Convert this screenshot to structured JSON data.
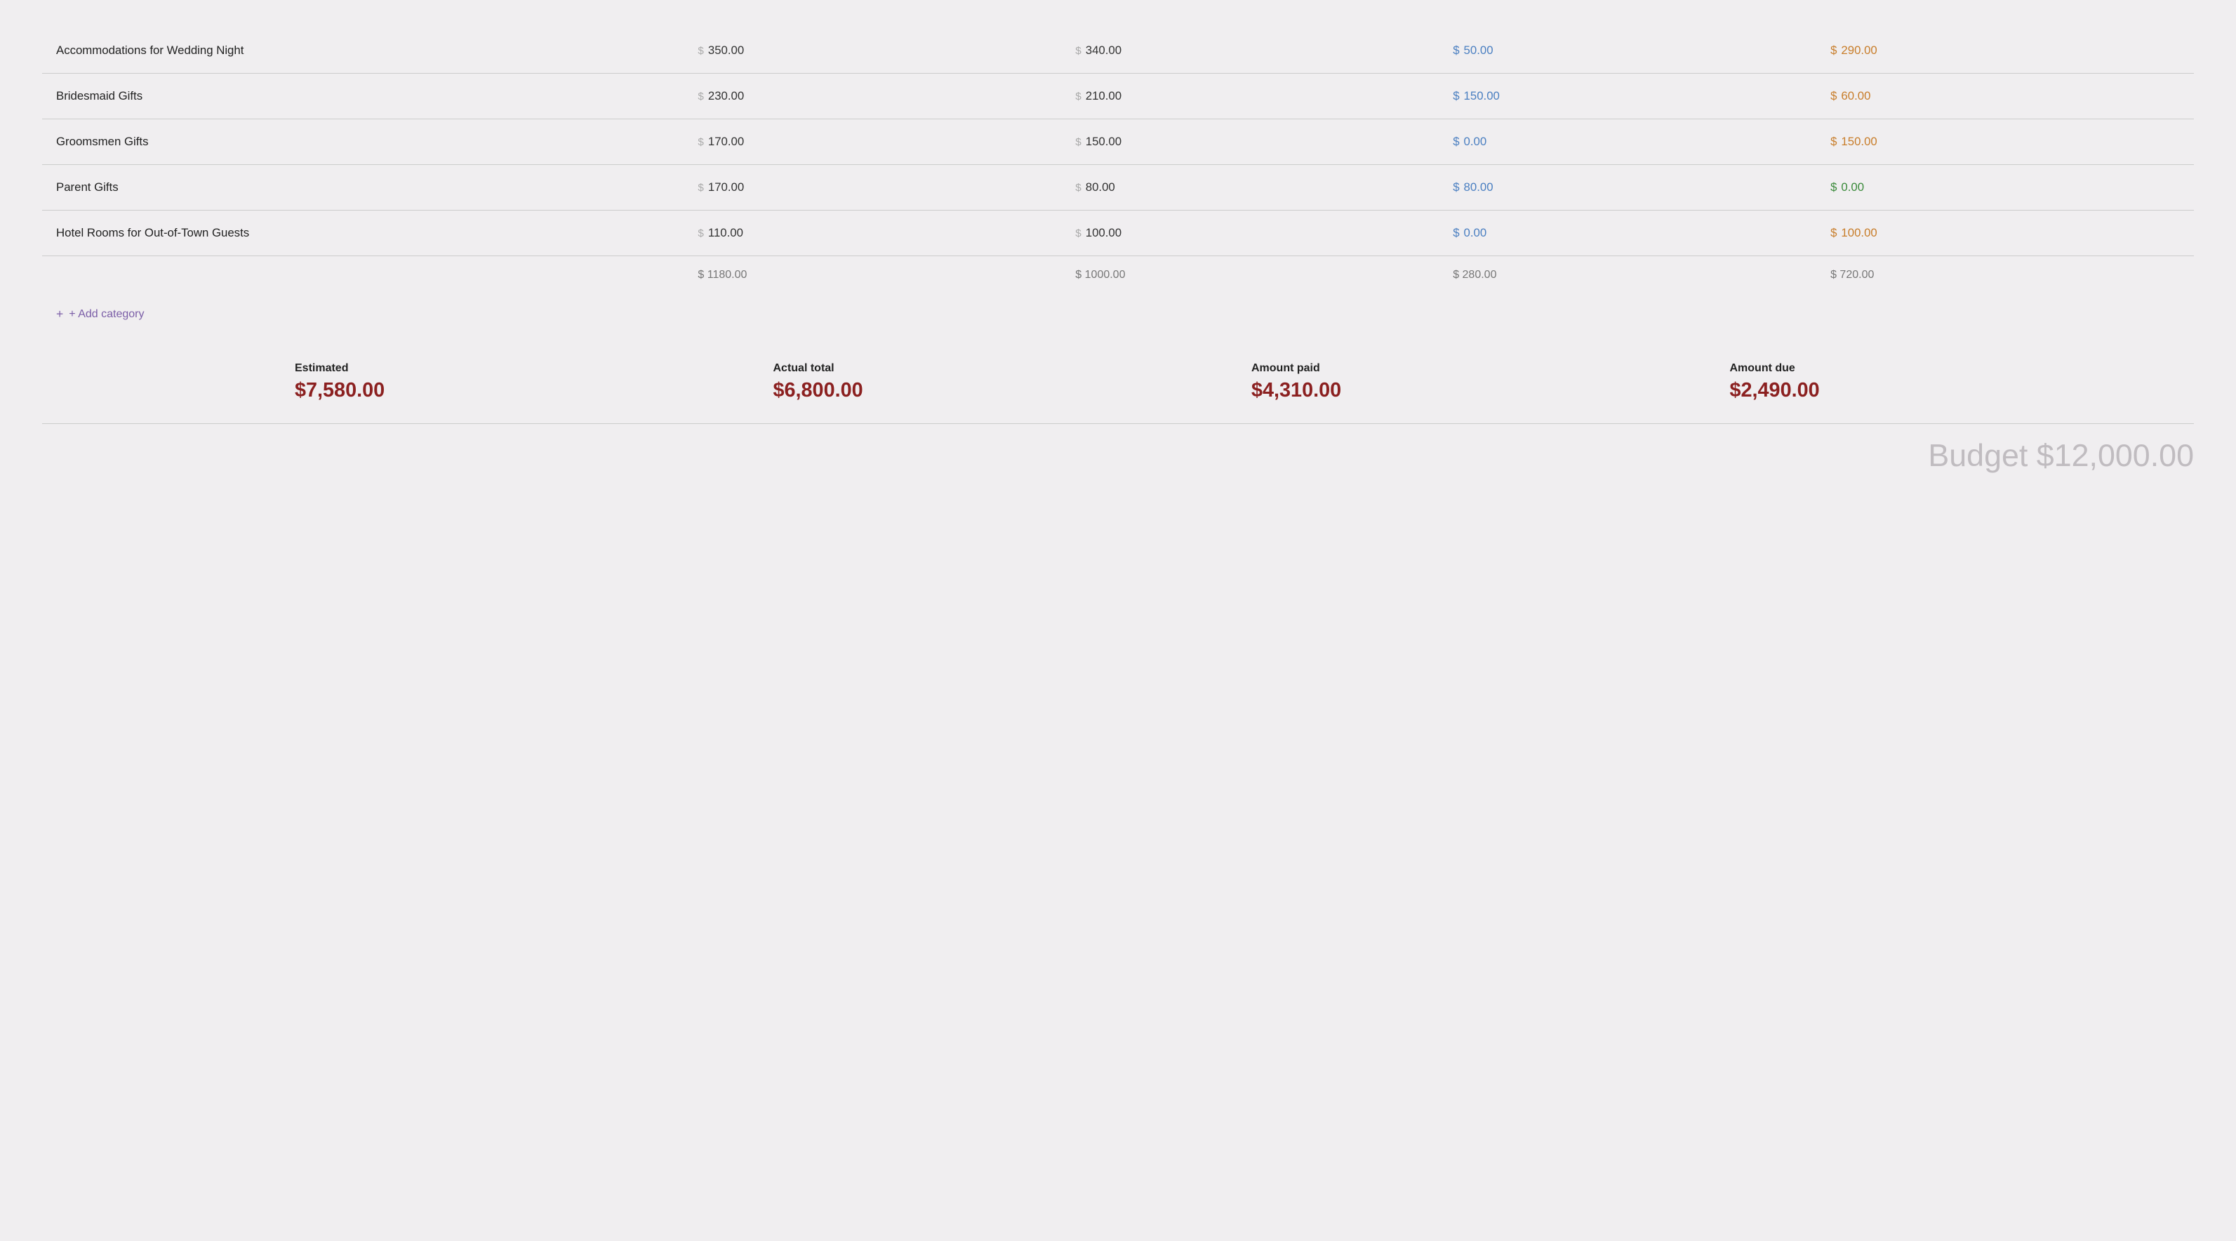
{
  "rows": [
    {
      "name": "Accommodations for Wedding Night",
      "estimated": "350.00",
      "actual": "340.00",
      "paid": "50.00",
      "due": "290.00",
      "paid_color": "blue",
      "due_color": "orange"
    },
    {
      "name": "Bridesmaid Gifts",
      "estimated": "230.00",
      "actual": "210.00",
      "paid": "150.00",
      "due": "60.00",
      "paid_color": "blue",
      "due_color": "orange"
    },
    {
      "name": "Groomsmen Gifts",
      "estimated": "170.00",
      "actual": "150.00",
      "paid": "0.00",
      "due": "150.00",
      "paid_color": "blue",
      "due_color": "orange"
    },
    {
      "name": "Parent Gifts",
      "estimated": "170.00",
      "actual": "80.00",
      "paid": "80.00",
      "due": "0.00",
      "paid_color": "blue",
      "due_color": "green"
    },
    {
      "name": "Hotel Rooms for Out-of-Town Guests",
      "estimated": "110.00",
      "actual": "100.00",
      "paid": "0.00",
      "due": "100.00",
      "paid_color": "blue",
      "due_color": "orange"
    }
  ],
  "subtotals": {
    "estimated": "$ 1180.00",
    "actual": "$ 1000.00",
    "paid": "$ 280.00",
    "due": "$ 720.00"
  },
  "add_category_label": "+ Add category",
  "summary": {
    "estimated_label": "Estimated",
    "estimated_value": "$7,580.00",
    "actual_label": "Actual total",
    "actual_value": "$6,800.00",
    "paid_label": "Amount paid",
    "paid_value": "$4,310.00",
    "due_label": "Amount due",
    "due_value": "$2,490.00"
  },
  "budget_label": "Budget $12,000.00",
  "dollar_sign": "$"
}
